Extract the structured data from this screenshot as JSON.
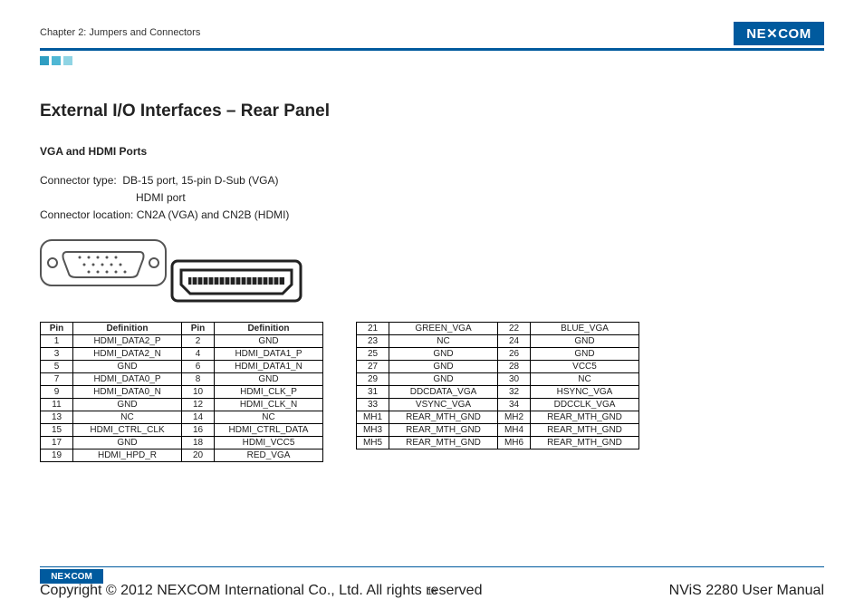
{
  "header": {
    "chapter_label": "Chapter 2: Jumpers and Connectors",
    "logo_text": "NE COM",
    "logo_x": "X"
  },
  "section": {
    "title": "External I/O Interfaces – Rear Panel",
    "subhead": "VGA and HDMI Ports",
    "type_label": "Connector type:",
    "type_line1": "DB-15 port, 15-pin D-Sub (VGA)",
    "type_line2": "HDMI port",
    "location_line": "Connector location: CN2A (VGA) and CN2B (HDMI)"
  },
  "table_headers": {
    "pin": "Pin",
    "definition": "Definition"
  },
  "left_rows": [
    {
      "p1": "1",
      "d1": "HDMI_DATA2_P",
      "p2": "2",
      "d2": "GND"
    },
    {
      "p1": "3",
      "d1": "HDMI_DATA2_N",
      "p2": "4",
      "d2": "HDMI_DATA1_P"
    },
    {
      "p1": "5",
      "d1": "GND",
      "p2": "6",
      "d2": "HDMI_DATA1_N"
    },
    {
      "p1": "7",
      "d1": "HDMI_DATA0_P",
      "p2": "8",
      "d2": "GND"
    },
    {
      "p1": "9",
      "d1": "HDMI_DATA0_N",
      "p2": "10",
      "d2": "HDMI_CLK_P"
    },
    {
      "p1": "11",
      "d1": "GND",
      "p2": "12",
      "d2": "HDMI_CLK_N"
    },
    {
      "p1": "13",
      "d1": "NC",
      "p2": "14",
      "d2": "NC"
    },
    {
      "p1": "15",
      "d1": "HDMI_CTRL_CLK",
      "p2": "16",
      "d2": "HDMI_CTRL_DATA"
    },
    {
      "p1": "17",
      "d1": "GND",
      "p2": "18",
      "d2": "HDMI_VCC5"
    },
    {
      "p1": "19",
      "d1": "HDMI_HPD_R",
      "p2": "20",
      "d2": "RED_VGA"
    }
  ],
  "right_rows": [
    {
      "p1": "21",
      "d1": "GREEN_VGA",
      "p2": "22",
      "d2": "BLUE_VGA"
    },
    {
      "p1": "23",
      "d1": "NC",
      "p2": "24",
      "d2": "GND"
    },
    {
      "p1": "25",
      "d1": "GND",
      "p2": "26",
      "d2": "GND"
    },
    {
      "p1": "27",
      "d1": "GND",
      "p2": "28",
      "d2": "VCC5"
    },
    {
      "p1": "29",
      "d1": "GND",
      "p2": "30",
      "d2": "NC"
    },
    {
      "p1": "31",
      "d1": "DDCDATA_VGA",
      "p2": "32",
      "d2": "HSYNC_VGA"
    },
    {
      "p1": "33",
      "d1": "VSYNC_VGA",
      "p2": "34",
      "d2": "DDCCLK_VGA"
    },
    {
      "p1": "MH1",
      "d1": "REAR_MTH_GND",
      "p2": "MH2",
      "d2": "REAR_MTH_GND"
    },
    {
      "p1": "MH3",
      "d1": "REAR_MTH_GND",
      "p2": "MH4",
      "d2": "REAR_MTH_GND"
    },
    {
      "p1": "MH5",
      "d1": "REAR_MTH_GND",
      "p2": "MH6",
      "d2": "REAR_MTH_GND"
    }
  ],
  "footer": {
    "copyright": "Copyright © 2012 NEXCOM International Co., Ltd. All rights reserved",
    "page_number": "16",
    "doc_title": "NViS 2280 User Manual"
  }
}
